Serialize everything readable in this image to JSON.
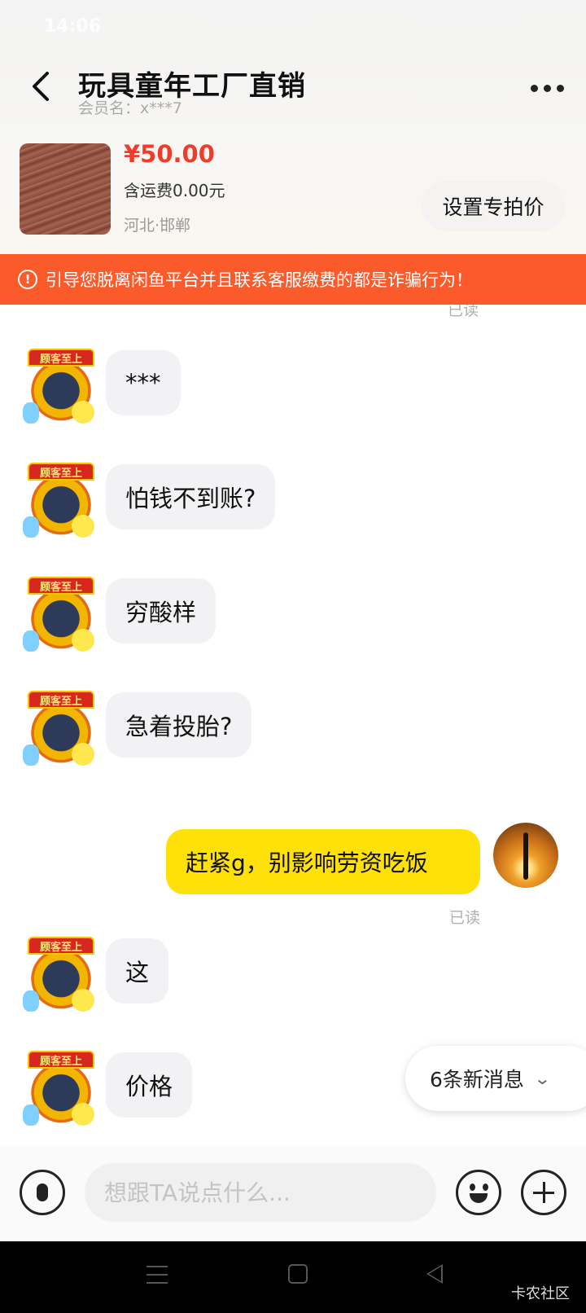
{
  "status": {
    "time": "14:06"
  },
  "header": {
    "title": "玩具童年工厂直销",
    "member": "会员名：x***7"
  },
  "product": {
    "price": "¥50.00",
    "shipping": "含运费0.00元",
    "location": "河北·邯郸",
    "special_button": "设置专拍价"
  },
  "warning": {
    "text": "引导您脱离闲鱼平台并且联系客服缴费的都是诈骗行为！"
  },
  "seller_avatar_banner": "顾客至上",
  "messages": [
    {
      "side": "left",
      "text": "***"
    },
    {
      "side": "left",
      "text": "怕钱不到账?"
    },
    {
      "side": "left",
      "text": "穷酸样"
    },
    {
      "side": "left",
      "text": "急着投胎?"
    },
    {
      "side": "right",
      "text": "赶紧g，别影响劳资吃饭"
    },
    {
      "side": "left",
      "text": "这"
    },
    {
      "side": "left",
      "text": "价格"
    }
  ],
  "read_label": "已读",
  "new_messages": "6条新消息",
  "input": {
    "placeholder": "想跟TA说点什么..."
  },
  "watermark": "卡农社区"
}
